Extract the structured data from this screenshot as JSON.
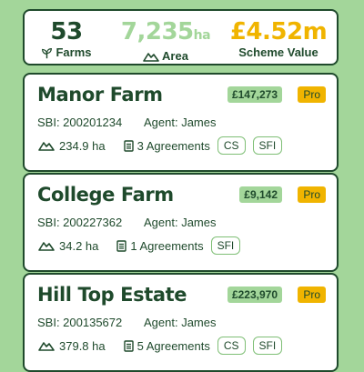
{
  "summary": {
    "farms_value": "53",
    "farms_label": "Farms",
    "area_value": "7,235",
    "area_unit": "ha",
    "area_label": "Area",
    "scheme_value": "£4.52m",
    "scheme_label": "Scheme Value"
  },
  "farms": [
    {
      "name": "Manor Farm",
      "value": "£147,273",
      "badge": "Pro",
      "sbi": "SBI: 200201234",
      "agent": "Agent: James",
      "area": "234.9 ha",
      "agreements": "3 Agreements",
      "tags": [
        "CS",
        "SFI"
      ]
    },
    {
      "name": "College Farm",
      "value": "£9,142",
      "badge": "Pro",
      "sbi": "SBI: 200227362",
      "agent": "Agent: James",
      "area": "34.2 ha",
      "agreements": "1 Agreements",
      "tags": [
        "SFI"
      ]
    },
    {
      "name": "Hill Top Estate",
      "value": "£223,970",
      "badge": "Pro",
      "sbi": "SBI: 200135672",
      "agent": "Agent: James",
      "area": "379.8 ha",
      "agreements": "5 Agreements",
      "tags": [
        "CS",
        "SFI"
      ]
    }
  ],
  "colors": {
    "background": "#a3d69a",
    "dark_green": "#1f4a2c",
    "accent_yellow": "#f0b400"
  },
  "icons": [
    "sprout-icon",
    "mountain-icon",
    "document-icon"
  ]
}
